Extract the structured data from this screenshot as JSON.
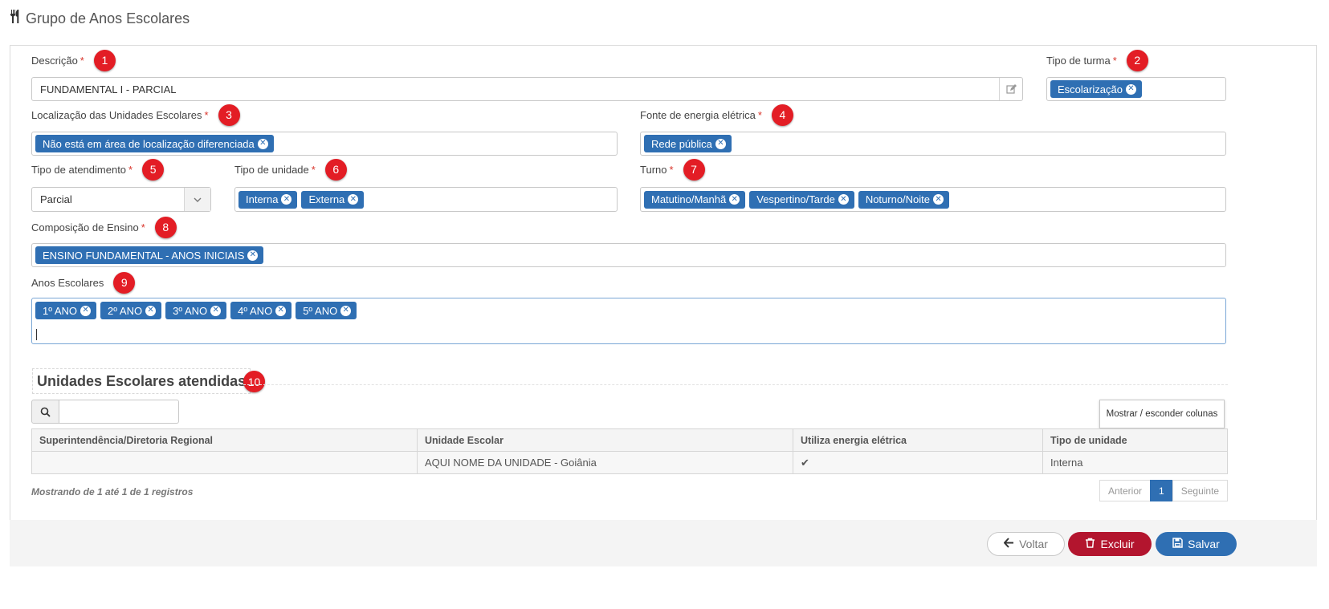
{
  "page": {
    "title": "Grupo de Anos Escolares"
  },
  "form": {
    "descricao": {
      "label": "Descrição",
      "value": "FUNDAMENTAL I - PARCIAL",
      "marker": "1"
    },
    "tipo_turma": {
      "label": "Tipo de turma",
      "marker": "2",
      "tags": [
        "Escolarização"
      ]
    },
    "localizacao": {
      "label": "Localização das Unidades Escolares",
      "marker": "3",
      "tags": [
        "Não está em área de localização diferenciada"
      ]
    },
    "fonte_energia": {
      "label": "Fonte de energia elétrica",
      "marker": "4",
      "tags": [
        "Rede pública"
      ]
    },
    "tipo_atendimento": {
      "label": "Tipo de atendimento",
      "marker": "5",
      "value": "Parcial"
    },
    "tipo_unidade": {
      "label": "Tipo de unidade",
      "marker": "6",
      "tags": [
        "Interna",
        "Externa"
      ]
    },
    "turno": {
      "label": "Turno",
      "marker": "7",
      "tags": [
        "Matutino/Manhã",
        "Vespertino/Tarde",
        "Noturno/Noite"
      ]
    },
    "composicao": {
      "label": "Composição de Ensino",
      "marker": "8",
      "tags": [
        "ENSINO FUNDAMENTAL - ANOS INICIAIS"
      ]
    },
    "anos": {
      "label": "Anos Escolares",
      "marker": "9",
      "tags": [
        "1º ANO",
        "2º ANO",
        "3º ANO",
        "4º ANO",
        "5º ANO"
      ]
    },
    "required_mark": "*",
    "tag_remove": "✕"
  },
  "unidades": {
    "title": "Unidades Escolares atendidas",
    "marker": "10",
    "columns_button": "Mostrar / esconder colunas",
    "columns": [
      "Superintendência/Diretoria Regional",
      "Unidade Escolar",
      "Utiliza energia elétrica",
      "Tipo de unidade"
    ],
    "rows": [
      {
        "regional": "",
        "unidade": "AQUI NOME DA UNIDADE - Goiânia",
        "energia": "✔",
        "tipo": "Interna"
      }
    ],
    "info": "Mostrando de 1 até 1 de 1 registros",
    "pager": {
      "prev": "Anterior",
      "current": "1",
      "next": "Seguinte"
    }
  },
  "actions": {
    "back": "Voltar",
    "delete": "Excluir",
    "save": "Salvar"
  },
  "colors": {
    "primary": "#2f6fb3",
    "danger": "#b3152e",
    "marker": "#e31d25"
  }
}
